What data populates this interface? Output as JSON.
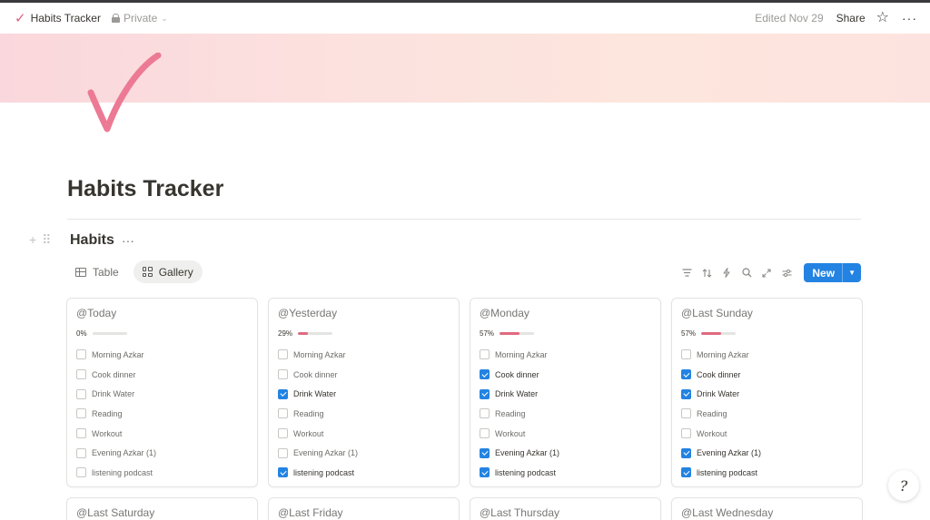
{
  "topbar": {
    "page_title": "Habits Tracker",
    "privacy": "Private",
    "edited": "Edited Nov 29",
    "share": "Share"
  },
  "page": {
    "icon": "pink-checkmark-icon",
    "title": "Habits Tracker"
  },
  "database": {
    "title": "Habits",
    "views": [
      {
        "label": "Table",
        "icon": "table-icon",
        "active": false
      },
      {
        "label": "Gallery",
        "icon": "gallery-icon",
        "active": true
      }
    ],
    "toolbar": {
      "icons": [
        "filter-icon",
        "sort-icon",
        "automation-bolt-icon",
        "search-icon",
        "expand-icon",
        "settings-sliders-icon"
      ],
      "new_label": "New"
    }
  },
  "accent_colors": {
    "progress_fill": "#e0697f",
    "checkbox_checked": "#2383e2",
    "new_button": "#2383e2"
  },
  "cards": [
    {
      "title": "@Today",
      "progress_text": "0%",
      "progress": 0,
      "habits": [
        {
          "label": "Morning Azkar",
          "checked": false
        },
        {
          "label": "Cook dinner",
          "checked": false
        },
        {
          "label": "Drink Water",
          "checked": false
        },
        {
          "label": "Reading",
          "checked": false
        },
        {
          "label": "Workout",
          "checked": false
        },
        {
          "label": "Evening Azkar (1)",
          "checked": false
        },
        {
          "label": "listening podcast",
          "checked": false
        }
      ]
    },
    {
      "title": "@Yesterday",
      "progress_text": "29%",
      "progress": 29,
      "habits": [
        {
          "label": "Morning Azkar",
          "checked": false
        },
        {
          "label": "Cook dinner",
          "checked": false
        },
        {
          "label": "Drink Water",
          "checked": true
        },
        {
          "label": "Reading",
          "checked": false
        },
        {
          "label": "Workout",
          "checked": false
        },
        {
          "label": "Evening Azkar (1)",
          "checked": false
        },
        {
          "label": "listening podcast",
          "checked": true
        }
      ]
    },
    {
      "title": "@Monday",
      "progress_text": "57%",
      "progress": 57,
      "habits": [
        {
          "label": "Morning Azkar",
          "checked": false
        },
        {
          "label": "Cook dinner",
          "checked": true
        },
        {
          "label": "Drink Water",
          "checked": true
        },
        {
          "label": "Reading",
          "checked": false
        },
        {
          "label": "Workout",
          "checked": false
        },
        {
          "label": "Evening Azkar (1)",
          "checked": true
        },
        {
          "label": "listening podcast",
          "checked": true
        }
      ]
    },
    {
      "title": "@Last Sunday",
      "progress_text": "57%",
      "progress": 57,
      "habits": [
        {
          "label": "Morning Azkar",
          "checked": false
        },
        {
          "label": "Cook dinner",
          "checked": true
        },
        {
          "label": "Drink Water",
          "checked": true
        },
        {
          "label": "Reading",
          "checked": false
        },
        {
          "label": "Workout",
          "checked": false
        },
        {
          "label": "Evening Azkar (1)",
          "checked": true
        },
        {
          "label": "listening podcast",
          "checked": true
        }
      ]
    }
  ],
  "more_cards": [
    {
      "title": "@Last Saturday"
    },
    {
      "title": "@Last Friday"
    },
    {
      "title": "@Last Thursday"
    },
    {
      "title": "@Last Wednesday"
    }
  ],
  "help_button": "?"
}
